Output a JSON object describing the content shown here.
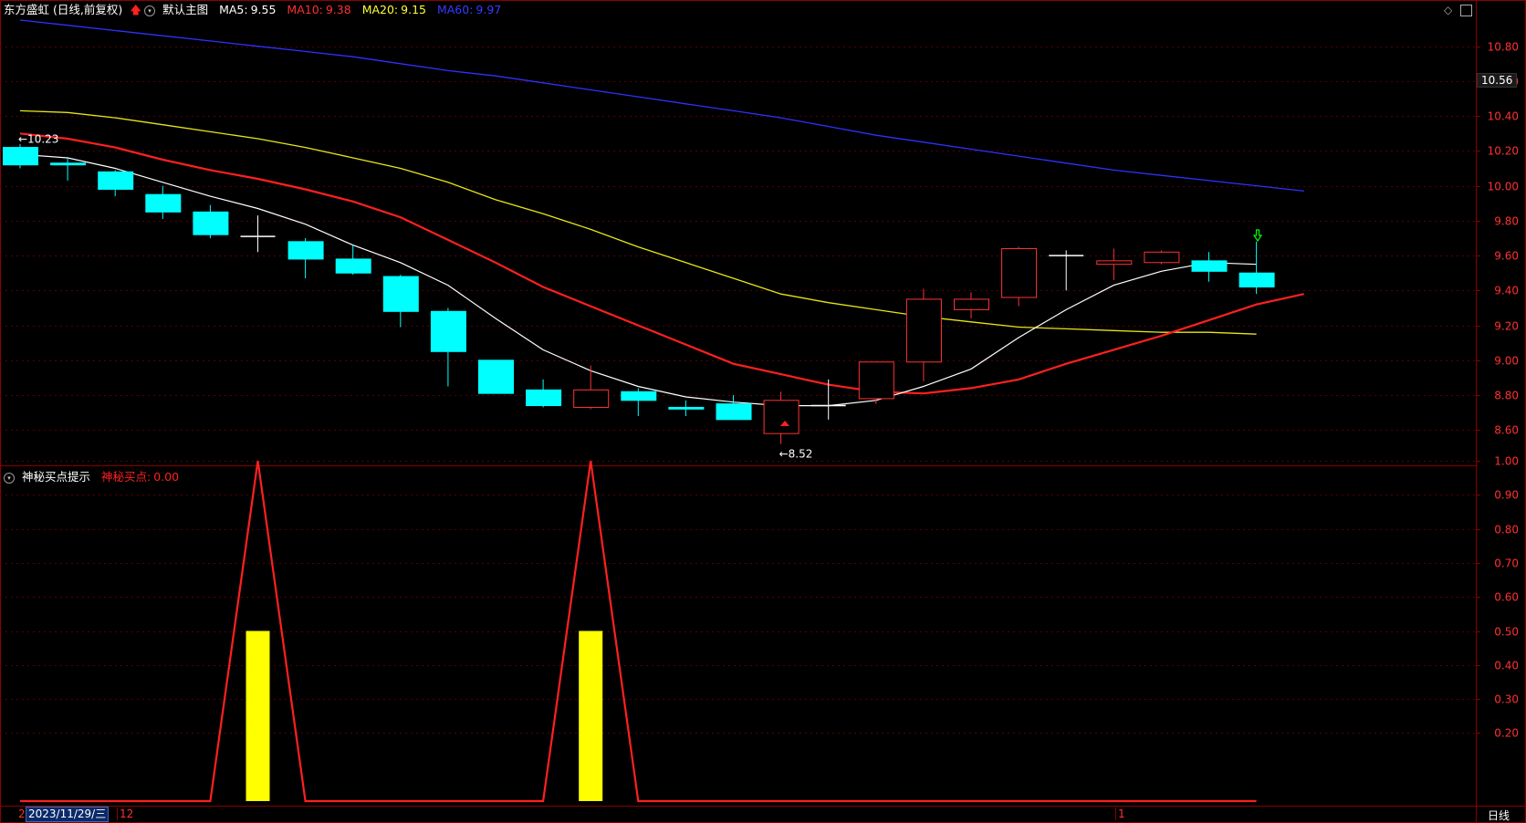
{
  "header": {
    "stock": "东方盛虹 (日线,前复权)",
    "main_chart_label": "默认主图",
    "ma5_label": "MA5:",
    "ma5_value": "9.55",
    "ma10_label": "MA10:",
    "ma10_value": "9.38",
    "ma20_label": "MA20:",
    "ma20_value": "9.15",
    "ma60_label": "MA60:",
    "ma60_value": "9.97"
  },
  "colors": {
    "up": "#ff3333",
    "down": "#00ffff",
    "ma5": "#ffffff",
    "ma10": "#ff2020",
    "ma20": "#e6e61a",
    "ma60": "#3030ff",
    "axis": "#8b0000",
    "grid": "#5a0000",
    "signal": "#ffff00"
  },
  "indicator": {
    "name": "神秘买点提示",
    "line_label": "神秘买点:",
    "line_value": "0.00"
  },
  "current_price_badge": "10.56",
  "footer": {
    "date_label": "2023/11/29/三",
    "month_12": "12",
    "month_1": "1",
    "period_tab": "日线",
    "left_digit": "2"
  },
  "chart_data": [
    {
      "type": "candlestick",
      "name": "main",
      "ylim": [
        8.45,
        10.95
      ],
      "yticks": [
        8.6,
        8.8,
        9.0,
        9.2,
        9.4,
        9.6,
        9.8,
        10.0,
        10.2,
        10.4,
        10.6,
        10.8
      ],
      "ytick_labels": [
        "8.60",
        "8.80",
        "9.00",
        "9.20",
        "9.40",
        "9.60",
        "9.80",
        "10.00",
        "10.20",
        "10.40",
        "10.60",
        "10.80"
      ],
      "candles": [
        {
          "o": 10.22,
          "h": 10.24,
          "l": 10.1,
          "c": 10.12
        },
        {
          "o": 10.13,
          "h": 10.16,
          "l": 10.03,
          "c": 10.12
        },
        {
          "o": 10.08,
          "h": 10.09,
          "l": 9.94,
          "c": 9.98
        },
        {
          "o": 9.95,
          "h": 10.0,
          "l": 9.81,
          "c": 9.85
        },
        {
          "o": 9.85,
          "h": 9.89,
          "l": 9.7,
          "c": 9.72
        },
        {
          "o": 9.71,
          "h": 9.83,
          "l": 9.62,
          "c": 9.71
        },
        {
          "o": 9.68,
          "h": 9.7,
          "l": 9.47,
          "c": 9.58
        },
        {
          "o": 9.58,
          "h": 9.66,
          "l": 9.49,
          "c": 9.5
        },
        {
          "o": 9.48,
          "h": 9.49,
          "l": 9.19,
          "c": 9.28
        },
        {
          "o": 9.28,
          "h": 9.3,
          "l": 8.85,
          "c": 9.05
        },
        {
          "o": 9.0,
          "h": 9.0,
          "l": 8.81,
          "c": 8.81
        },
        {
          "o": 8.83,
          "h": 8.89,
          "l": 8.73,
          "c": 8.74
        },
        {
          "o": 8.73,
          "h": 8.97,
          "l": 8.72,
          "c": 8.83
        },
        {
          "o": 8.82,
          "h": 8.84,
          "l": 8.68,
          "c": 8.77
        },
        {
          "o": 8.73,
          "h": 8.77,
          "l": 8.68,
          "c": 8.72
        },
        {
          "o": 8.75,
          "h": 8.8,
          "l": 8.66,
          "c": 8.66
        },
        {
          "o": 8.58,
          "h": 8.82,
          "l": 8.52,
          "c": 8.77
        },
        {
          "o": 8.74,
          "h": 8.89,
          "l": 8.66,
          "c": 8.74
        },
        {
          "o": 8.78,
          "h": 8.99,
          "l": 8.75,
          "c": 8.99
        },
        {
          "o": 8.99,
          "h": 9.41,
          "l": 8.88,
          "c": 9.35
        },
        {
          "o": 9.29,
          "h": 9.39,
          "l": 9.24,
          "c": 9.35
        },
        {
          "o": 9.36,
          "h": 9.65,
          "l": 9.31,
          "c": 9.64
        },
        {
          "o": 9.6,
          "h": 9.63,
          "l": 9.4,
          "c": 9.6
        },
        {
          "o": 9.55,
          "h": 9.64,
          "l": 9.46,
          "c": 9.57
        },
        {
          "o": 9.56,
          "h": 9.63,
          "l": 9.55,
          "c": 9.62
        },
        {
          "o": 9.57,
          "h": 9.62,
          "l": 9.45,
          "c": 9.51
        },
        {
          "o": 9.5,
          "h": 9.68,
          "l": 9.38,
          "c": 9.42
        }
      ],
      "ma5": [
        10.18,
        10.16,
        10.1,
        10.02,
        9.94,
        9.87,
        9.78,
        9.66,
        9.56,
        9.43,
        9.24,
        9.06,
        8.94,
        8.85,
        8.79,
        8.76,
        8.74,
        8.74,
        8.77,
        8.85,
        8.95,
        9.13,
        9.29,
        9.43,
        9.51,
        9.56,
        9.55
      ],
      "ma10": [
        10.3,
        10.27,
        10.22,
        10.15,
        10.09,
        10.04,
        9.98,
        9.91,
        9.82,
        9.69,
        9.56,
        9.42,
        9.31,
        9.2,
        9.09,
        8.98,
        8.92,
        8.86,
        8.82,
        8.81,
        8.84,
        8.89,
        8.98,
        9.06,
        9.14,
        9.23,
        9.32,
        9.38
      ],
      "ma20": [
        10.43,
        10.42,
        10.39,
        10.35,
        10.31,
        10.27,
        10.22,
        10.16,
        10.1,
        10.02,
        9.92,
        9.84,
        9.75,
        9.65,
        9.56,
        9.47,
        9.38,
        9.33,
        9.29,
        9.25,
        9.22,
        9.19,
        9.18,
        9.17,
        9.16,
        9.16,
        9.15
      ],
      "ma60": [
        10.95,
        10.92,
        10.89,
        10.86,
        10.83,
        10.8,
        10.77,
        10.74,
        10.7,
        10.66,
        10.63,
        10.59,
        10.55,
        10.51,
        10.47,
        10.43,
        10.39,
        10.34,
        10.29,
        10.25,
        10.21,
        10.17,
        10.13,
        10.09,
        10.06,
        10.03,
        10.0,
        9.97
      ],
      "annotations": [
        {
          "label": "←10.23",
          "index": 0,
          "value": 10.23
        },
        {
          "label": "←8.52",
          "index": 16,
          "value": 8.52
        }
      ]
    },
    {
      "type": "line",
      "name": "神秘买点",
      "ylim": [
        0,
        1.0
      ],
      "yticks": [
        0.2,
        0.3,
        0.4,
        0.5,
        0.6,
        0.7,
        0.8,
        0.9,
        1.0
      ],
      "ytick_labels": [
        "0.20",
        "0.30",
        "0.40",
        "0.50",
        "0.60",
        "0.70",
        "0.80",
        "0.90",
        "1.00"
      ],
      "values": [
        0,
        0,
        0,
        0,
        0,
        1,
        0,
        0,
        0,
        0,
        0,
        0,
        1,
        0,
        0,
        0,
        0,
        0,
        0,
        0,
        0,
        0,
        0,
        0,
        0,
        0,
        0
      ],
      "bars": [
        0,
        0,
        0,
        0,
        0,
        0.5,
        0,
        0,
        0,
        0,
        0,
        0,
        0.5,
        0,
        0,
        0,
        0,
        0,
        0,
        0,
        0,
        0,
        0,
        0,
        0,
        0,
        0
      ]
    }
  ]
}
